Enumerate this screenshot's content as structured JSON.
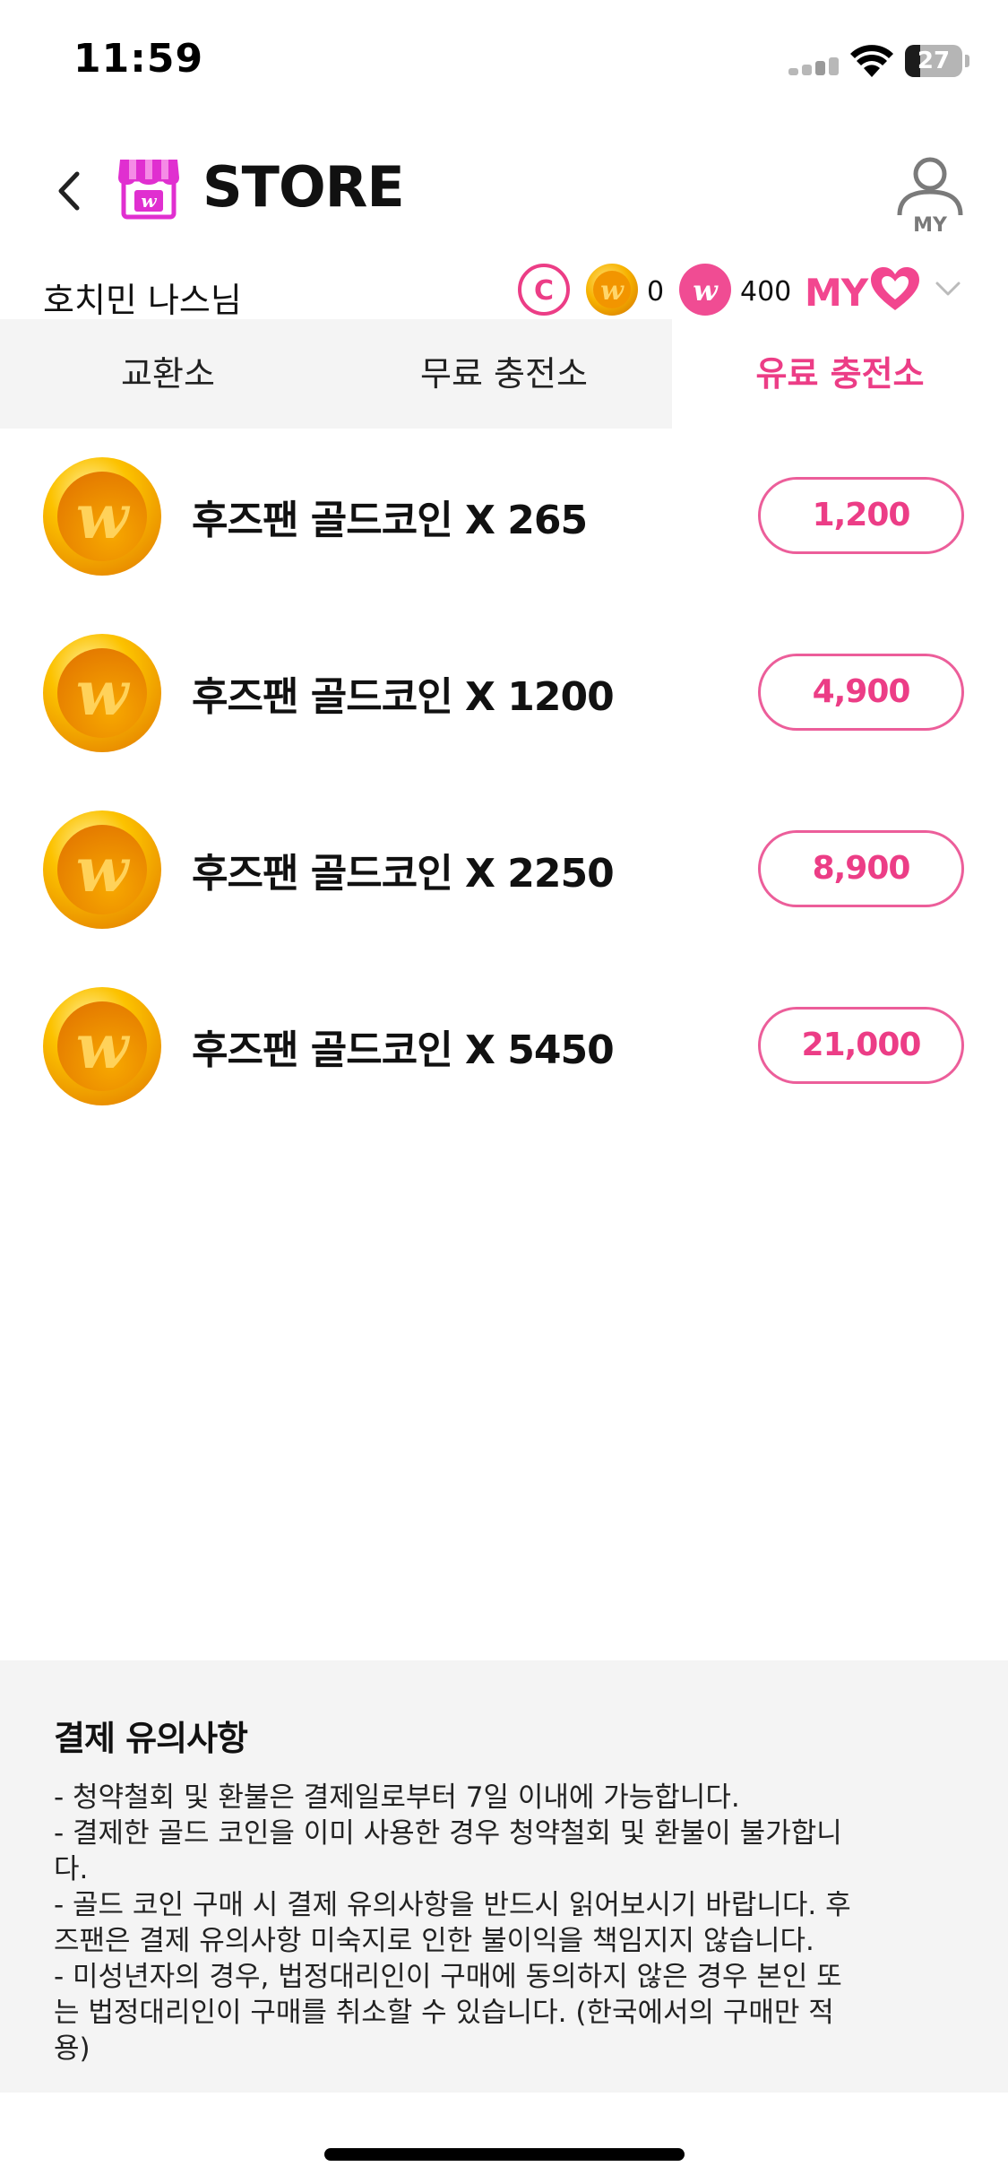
{
  "status_bar": {
    "time": "11:59",
    "battery": "27",
    "battery_level": 0.27
  },
  "header": {
    "title": "STORE",
    "my_icon_label": "MY",
    "store_icon_letter": "w"
  },
  "user": {
    "name": "호치민 나스님",
    "currency_c_label": "C",
    "gold_count": "0",
    "pink_count": "400",
    "my_badge": "MY"
  },
  "tabs": [
    {
      "label": "교환소",
      "active": false
    },
    {
      "label": "무료 충전소",
      "active": false
    },
    {
      "label": "유료 충전소",
      "active": true
    }
  ],
  "products": [
    {
      "name": "후즈팬 골드코인 X 265",
      "price": "1,200"
    },
    {
      "name": "후즈팬 골드코인 X 1200",
      "price": "4,900"
    },
    {
      "name": "후즈팬 골드코인 X 2250",
      "price": "8,900"
    },
    {
      "name": "후즈팬 골드코인 X 5450",
      "price": "21,000"
    }
  ],
  "notice": {
    "title": "결제 유의사항",
    "lines": [
      "- 청약철회 및 환불은 결제일로부터 7일 이내에 가능합니다.",
      "- 결제한 골드 코인을 이미 사용한 경우 청약철회 및 환불이 불가합니",
      "다.",
      "- 골드 코인 구매 시 결제 유의사항을 반드시 읽어보시기 바랍니다. 후",
      "즈팬은 결제 유의사항 미숙지로 인한 불이익을 책임지지 않습니다.",
      "- 미성년자의 경우, 법정대리인이 구매에 동의하지 않은 경우 본인 또",
      "는 법정대리인이 구매를 취소할 수 있습니다. (한국에서의 구매만 적",
      "용)"
    ]
  },
  "colors": {
    "accent": "#ec3d86",
    "tab_bg": "#f4f4f4",
    "notice_bg": "#f4f4f4",
    "coin_gold": "#f5a300"
  },
  "icons": {
    "back": "chevron-left-icon",
    "store": "store-icon",
    "profile": "person-icon",
    "coin": "gold-coin-icon",
    "heart": "heart-icon",
    "dropdown": "chevron-down-icon"
  }
}
